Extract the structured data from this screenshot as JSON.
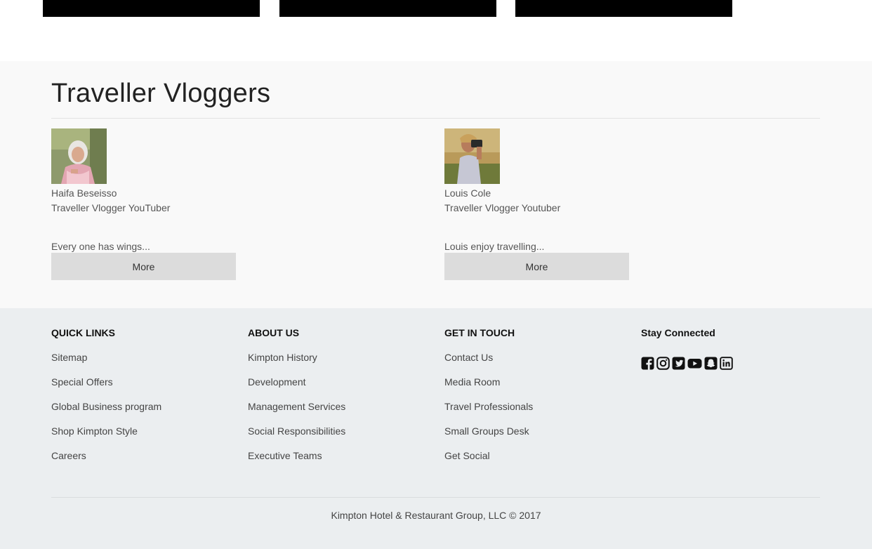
{
  "section": {
    "title": "Traveller Vloggers"
  },
  "vloggers": [
    {
      "name": "Haifa Beseisso",
      "role": "Traveller Vlogger YouTuber",
      "description": "Every one has wings...",
      "more_label": "More"
    },
    {
      "name": "Louis Cole",
      "role": "Traveller Vlogger Youtuber",
      "description": "Louis enjoy travelling...",
      "more_label": "More"
    }
  ],
  "footer": {
    "quick_links": {
      "heading": "QUICK LINKS",
      "items": [
        "Sitemap",
        "Special Offers",
        "Global Business program",
        "Shop Kimpton Style",
        "Careers"
      ]
    },
    "about_us": {
      "heading": "ABOUT US",
      "items": [
        "Kimpton History",
        "Development",
        "Management Services",
        "Social Responsibilities",
        "Executive Teams"
      ]
    },
    "get_in_touch": {
      "heading": "GET IN TOUCH",
      "items": [
        "Contact Us",
        "Media Room",
        "Travel Professionals",
        "Small Groups Desk",
        "Get Social"
      ]
    },
    "stay_connected": {
      "heading": "Stay Connected",
      "icons": [
        "facebook-icon",
        "instagram-icon",
        "twitter-icon",
        "youtube-icon",
        "snapchat-icon",
        "linkedin-icon"
      ]
    },
    "copyright": "Kimpton Hotel & Restaurant Group, LLC © 2017"
  },
  "colors": {
    "vloggers_bg": "#f9f9f9",
    "footer_bg": "#ebeef0",
    "button_bg": "#dcdcdc",
    "tile": "#000000"
  }
}
